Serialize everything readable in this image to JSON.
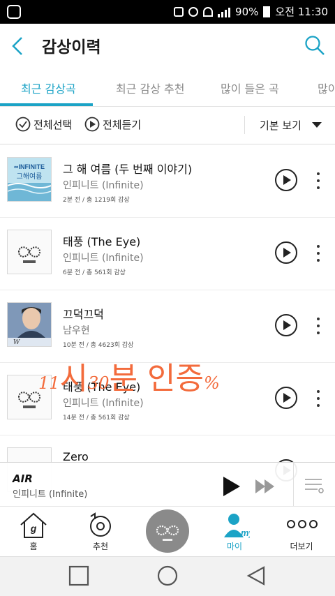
{
  "status_bar": {
    "battery": "90%",
    "time": "오전 11:30"
  },
  "header": {
    "title": "감상이력"
  },
  "tabs": [
    {
      "label": "최근 감상곡",
      "active": true
    },
    {
      "label": "최근 감상 추천",
      "active": false
    },
    {
      "label": "많이 들은 곡",
      "active": false
    },
    {
      "label": "많이",
      "active": false
    }
  ],
  "toolbar": {
    "select_all": "전체선택",
    "play_all": "전체듣기",
    "view_mode": "기본 보기"
  },
  "songs": [
    {
      "title": "그 해 여름 (두 번째 이야기)",
      "artist": "인피니트 (Infinite)",
      "meta": "2분 전 / 총 1219회 감상",
      "cover": "summer"
    },
    {
      "title": "태풍 (The Eye)",
      "artist": "인피니트 (Infinite)",
      "meta": "6분 전 / 총 561회 감상",
      "cover": "infinite"
    },
    {
      "title": "끄덕끄덕",
      "artist": "남우현",
      "meta": "10분 전 / 총 4623회 감상",
      "cover": "portrait"
    },
    {
      "title": "태풍 (The Eye)",
      "artist": "인피니트 (Infinite)",
      "meta": "14분 전 / 총 561회 감상",
      "cover": "infinite"
    },
    {
      "title": "Zero",
      "artist": "",
      "meta": "",
      "cover": "infinite"
    }
  ],
  "overlay": {
    "hour": "11",
    "si": "시",
    "minute": "30",
    "rest": "분 인증",
    "mark": "%"
  },
  "now_playing": {
    "title": "AIR",
    "artist": "인피니트 (Infinite)"
  },
  "bottom_nav": [
    {
      "label": "홈"
    },
    {
      "label": "추천"
    },
    {
      "label": ""
    },
    {
      "label": "마이",
      "active": true
    },
    {
      "label": "더보기"
    }
  ],
  "colors": {
    "accent": "#1ba3c6",
    "overlay": "#f36b3c"
  }
}
